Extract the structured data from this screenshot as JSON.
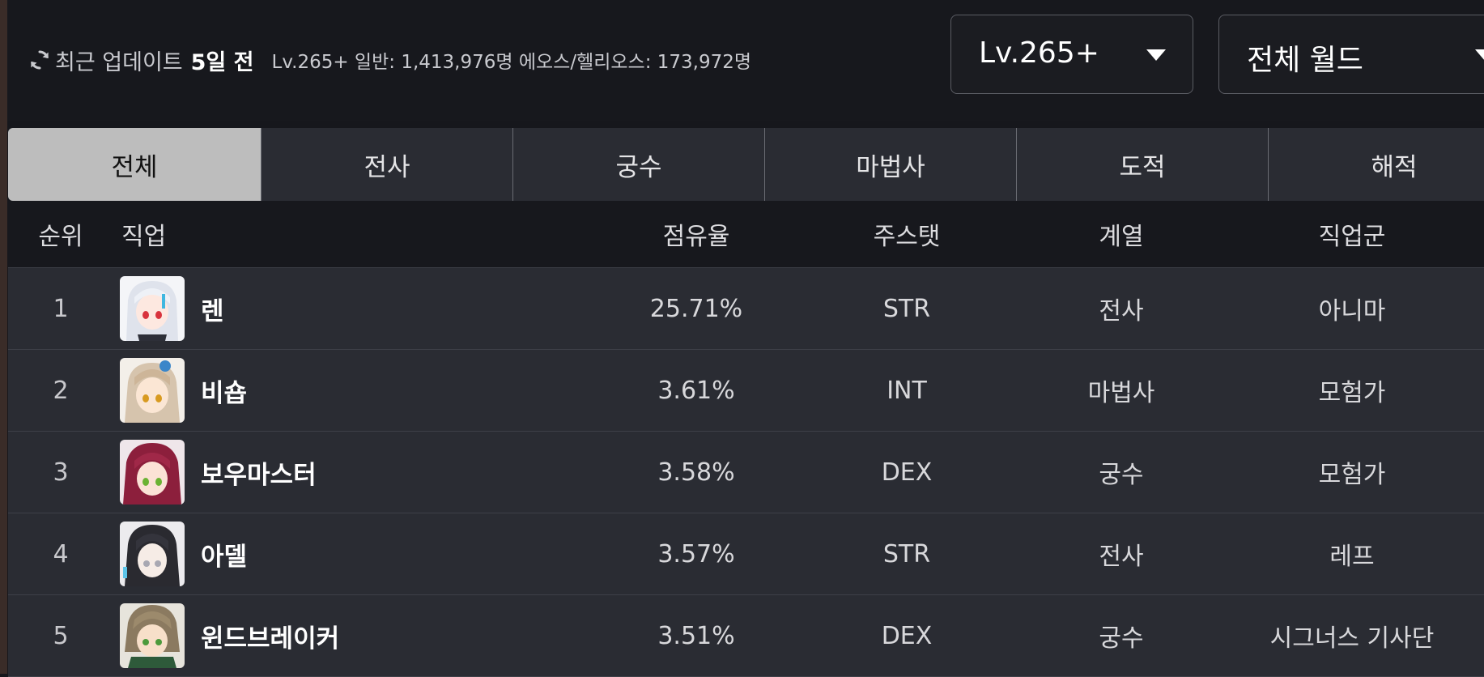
{
  "header": {
    "icon": "refresh-icon",
    "update_label": "최근 업데이트",
    "update_time": "5일 전",
    "stats": "Lv.265+ 일반: 1,413,976명 에오스/헬리오스: 173,972명"
  },
  "filters": {
    "level": "Lv.265+",
    "world": "전체 월드"
  },
  "tabs": [
    {
      "label": "전체",
      "active": true
    },
    {
      "label": "전사"
    },
    {
      "label": "궁수"
    },
    {
      "label": "마법사"
    },
    {
      "label": "도적"
    },
    {
      "label": "해적"
    }
  ],
  "table": {
    "headers": {
      "rank": "순위",
      "job": "직업",
      "share": "점유율",
      "main_stat": "주스탯",
      "branch": "계열",
      "group": "직업군"
    },
    "rows": [
      {
        "rank": "1",
        "job": "렌",
        "share": "25.71%",
        "main_stat": "STR",
        "branch": "전사",
        "group": "아니마"
      },
      {
        "rank": "2",
        "job": "비숍",
        "share": "3.61%",
        "main_stat": "INT",
        "branch": "마법사",
        "group": "모험가"
      },
      {
        "rank": "3",
        "job": "보우마스터",
        "share": "3.58%",
        "main_stat": "DEX",
        "branch": "궁수",
        "group": "모험가"
      },
      {
        "rank": "4",
        "job": "아델",
        "share": "3.57%",
        "main_stat": "STR",
        "branch": "전사",
        "group": "레프"
      },
      {
        "rank": "5",
        "job": "윈드브레이커",
        "share": "3.51%",
        "main_stat": "DEX",
        "branch": "궁수",
        "group": "시그너스 기사단"
      }
    ]
  },
  "colors": {
    "background": "#16171c",
    "row": "#2a2c33",
    "active_tab": "#bdbdbd"
  }
}
